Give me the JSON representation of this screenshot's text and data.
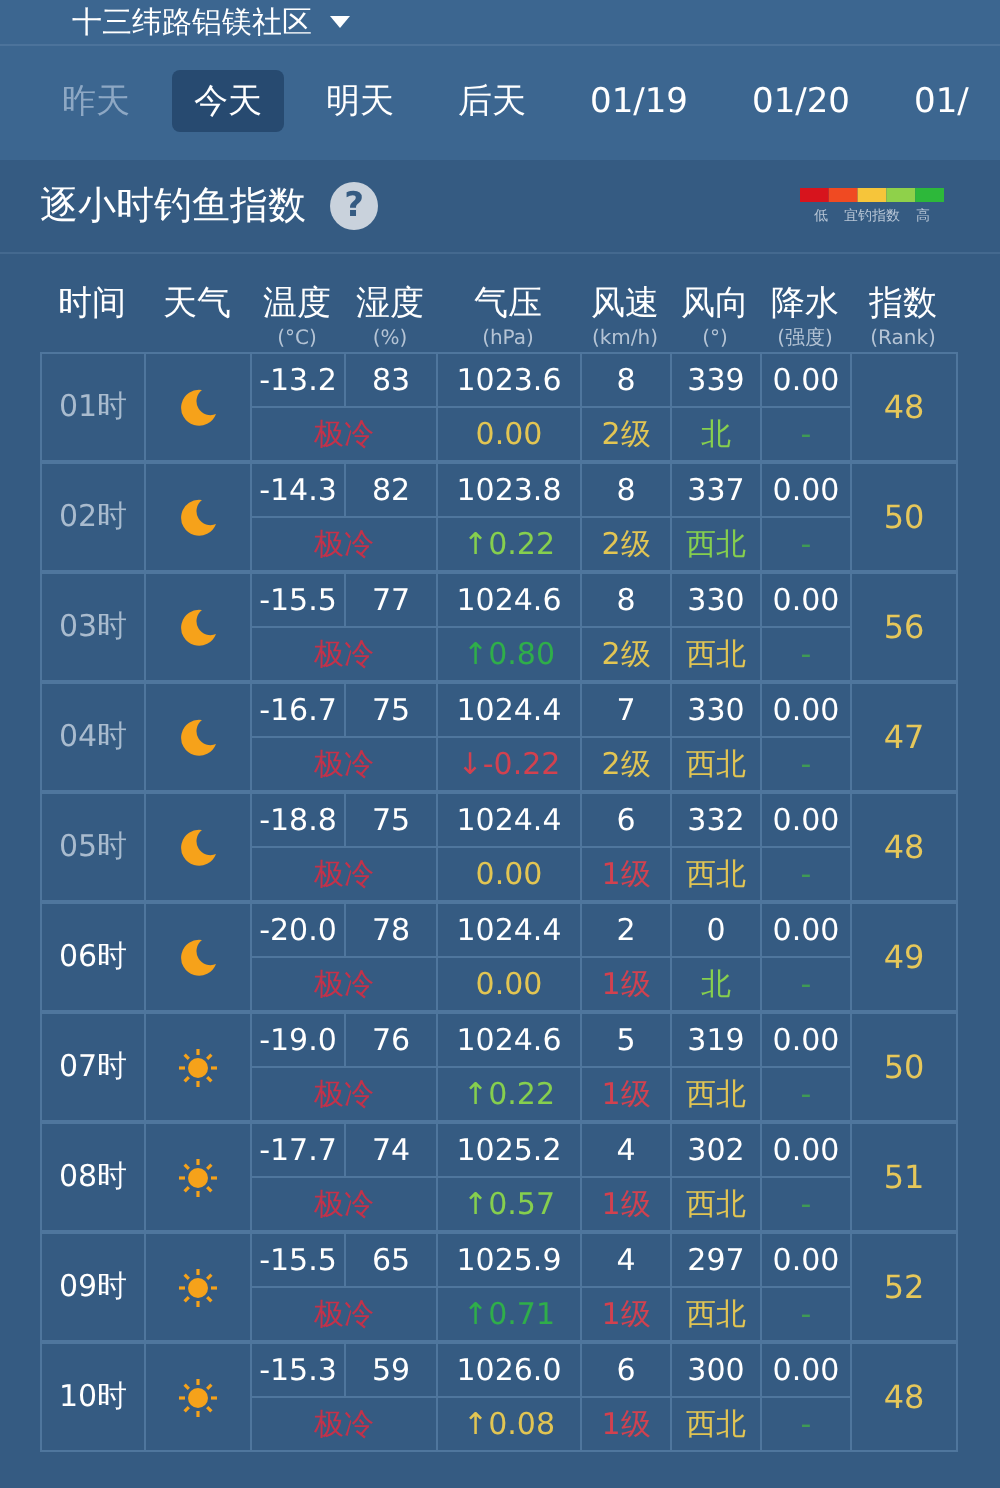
{
  "location": {
    "title": "十三纬路铝镁社区"
  },
  "tabs": [
    {
      "label": "昨天",
      "selected": false,
      "disabled": true
    },
    {
      "label": "今天",
      "selected": true,
      "disabled": false
    },
    {
      "label": "明天",
      "selected": false,
      "disabled": false
    },
    {
      "label": "后天",
      "selected": false,
      "disabled": false
    },
    {
      "label": "01/19",
      "selected": false,
      "disabled": false
    },
    {
      "label": "01/20",
      "selected": false,
      "disabled": false
    },
    {
      "label": "01/",
      "selected": false,
      "disabled": false
    }
  ],
  "section": {
    "title": "逐小时钓鱼指数",
    "help": "?",
    "legend": {
      "low": "低",
      "middle": "宜钓指数",
      "high": "高"
    }
  },
  "table": {
    "columns": [
      {
        "label": "时间"
      },
      {
        "label": "天气"
      },
      {
        "label": "温度",
        "unit": "(°C)"
      },
      {
        "label": "湿度",
        "unit": "(%)"
      },
      {
        "label": "气压",
        "unit": "(hPa)"
      },
      {
        "label": "风速",
        "unit": "(km/h)"
      },
      {
        "label": "风向",
        "unit": "(°)"
      },
      {
        "label": "降水",
        "unit": "(强度)"
      },
      {
        "label": "指数",
        "unit": "(Rank)"
      }
    ],
    "rows": [
      {
        "time": "01时",
        "past": true,
        "weather": {
          "kind": "moon"
        },
        "temp": "-13.2",
        "humidity": "83",
        "pressure": "1023.6",
        "wind_speed": "8",
        "wind_deg": "339",
        "precip": "0.00",
        "feel": "极冷",
        "pressure_change": {
          "text": "0.00",
          "color": "#e2c553"
        },
        "wind_level": {
          "text": "2级",
          "color": "#e2c553"
        },
        "direction": {
          "text": "北",
          "color": "#86cf4e"
        },
        "precip_level": "-",
        "rank": "48"
      },
      {
        "time": "02时",
        "past": true,
        "weather": {
          "kind": "moon"
        },
        "temp": "-14.3",
        "humidity": "82",
        "pressure": "1023.8",
        "wind_speed": "8",
        "wind_deg": "337",
        "precip": "0.00",
        "feel": "极冷",
        "pressure_change": {
          "text": "↑0.22",
          "color": "#86cf4e"
        },
        "wind_level": {
          "text": "2级",
          "color": "#e2c553"
        },
        "direction": {
          "text": "西北",
          "color": "#86cf4e"
        },
        "precip_level": "-",
        "rank": "50"
      },
      {
        "time": "03时",
        "past": true,
        "weather": {
          "kind": "moon"
        },
        "temp": "-15.5",
        "humidity": "77",
        "pressure": "1024.6",
        "wind_speed": "8",
        "wind_deg": "330",
        "precip": "0.00",
        "feel": "极冷",
        "pressure_change": {
          "text": "↑0.80",
          "color": "#2fae4a"
        },
        "wind_level": {
          "text": "2级",
          "color": "#e2c553"
        },
        "direction": {
          "text": "西北",
          "color": "#e2c553"
        },
        "precip_level": "-",
        "rank": "56"
      },
      {
        "time": "04时",
        "past": true,
        "weather": {
          "kind": "moon"
        },
        "temp": "-16.7",
        "humidity": "75",
        "pressure": "1024.4",
        "wind_speed": "7",
        "wind_deg": "330",
        "precip": "0.00",
        "feel": "极冷",
        "pressure_change": {
          "text": "↓-0.22",
          "color": "#d2414f"
        },
        "wind_level": {
          "text": "2级",
          "color": "#e2c553"
        },
        "direction": {
          "text": "西北",
          "color": "#e2c553"
        },
        "precip_level": "-",
        "rank": "47"
      },
      {
        "time": "05时",
        "past": true,
        "weather": {
          "kind": "moon"
        },
        "temp": "-18.8",
        "humidity": "75",
        "pressure": "1024.4",
        "wind_speed": "6",
        "wind_deg": "332",
        "precip": "0.00",
        "feel": "极冷",
        "pressure_change": {
          "text": "0.00",
          "color": "#e2c553"
        },
        "wind_level": {
          "text": "1级",
          "color": "#d2414f"
        },
        "direction": {
          "text": "西北",
          "color": "#e2c553"
        },
        "precip_level": "-",
        "rank": "48"
      },
      {
        "time": "06时",
        "past": false,
        "weather": {
          "kind": "moon"
        },
        "temp": "-20.0",
        "humidity": "78",
        "pressure": "1024.4",
        "wind_speed": "2",
        "wind_deg": "0",
        "precip": "0.00",
        "feel": "极冷",
        "pressure_change": {
          "text": "0.00",
          "color": "#e2c553"
        },
        "wind_level": {
          "text": "1级",
          "color": "#d2414f"
        },
        "direction": {
          "text": "北",
          "color": "#86cf4e"
        },
        "precip_level": "-",
        "rank": "49"
      },
      {
        "time": "07时",
        "past": false,
        "weather": {
          "kind": "sun"
        },
        "temp": "-19.0",
        "humidity": "76",
        "pressure": "1024.6",
        "wind_speed": "5",
        "wind_deg": "319",
        "precip": "0.00",
        "feel": "极冷",
        "pressure_change": {
          "text": "↑0.22",
          "color": "#86cf4e"
        },
        "wind_level": {
          "text": "1级",
          "color": "#d2414f"
        },
        "direction": {
          "text": "西北",
          "color": "#e2c553"
        },
        "precip_level": "-",
        "rank": "50"
      },
      {
        "time": "08时",
        "past": false,
        "weather": {
          "kind": "sun"
        },
        "temp": "-17.7",
        "humidity": "74",
        "pressure": "1025.2",
        "wind_speed": "4",
        "wind_deg": "302",
        "precip": "0.00",
        "feel": "极冷",
        "pressure_change": {
          "text": "↑0.57",
          "color": "#86cf4e"
        },
        "wind_level": {
          "text": "1级",
          "color": "#d2414f"
        },
        "direction": {
          "text": "西北",
          "color": "#e2c553"
        },
        "precip_level": "-",
        "rank": "51"
      },
      {
        "time": "09时",
        "past": false,
        "weather": {
          "kind": "sun"
        },
        "temp": "-15.5",
        "humidity": "65",
        "pressure": "1025.9",
        "wind_speed": "4",
        "wind_deg": "297",
        "precip": "0.00",
        "feel": "极冷",
        "pressure_change": {
          "text": "↑0.71",
          "color": "#2fae4a"
        },
        "wind_level": {
          "text": "1级",
          "color": "#d2414f"
        },
        "direction": {
          "text": "西北",
          "color": "#e2c553"
        },
        "precip_level": "-",
        "rank": "52"
      },
      {
        "time": "10时",
        "past": false,
        "weather": {
          "kind": "sun"
        },
        "temp": "-15.3",
        "humidity": "59",
        "pressure": "1026.0",
        "wind_speed": "6",
        "wind_deg": "300",
        "precip": "0.00",
        "feel": "极冷",
        "pressure_change": {
          "text": "↑0.08",
          "color": "#e2c553"
        },
        "wind_level": {
          "text": "1级",
          "color": "#d2414f"
        },
        "direction": {
          "text": "西北",
          "color": "#e2c553"
        },
        "precip_level": "-",
        "rank": "48"
      }
    ]
  }
}
